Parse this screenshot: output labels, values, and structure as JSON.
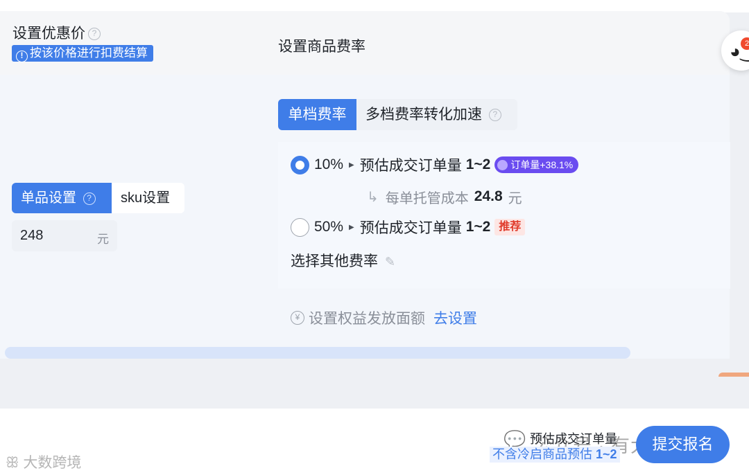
{
  "header": {
    "discount_title": "设置优惠价",
    "price_hint": "按该价格进行扣费结算",
    "rate_title": "设置商品费率"
  },
  "mascot": {
    "badge": "2"
  },
  "price_mode": {
    "tabs": [
      "单品设置",
      "sku设置"
    ],
    "selected": "单品设置",
    "price_value": "248",
    "price_unit": "元"
  },
  "rate": {
    "tabs": [
      "单档费率",
      "多档费率转化加速"
    ],
    "selected_tab": "单档费率",
    "options": [
      {
        "pct": "10%",
        "estimate_label": "预估成交订单量",
        "estimate_value": "1~2",
        "badge": "订单量+38.1%",
        "checked": true
      },
      {
        "pct": "50%",
        "estimate_label": "预估成交订单量",
        "estimate_value": "1~2",
        "badge": "推荐",
        "checked": false
      }
    ],
    "cost_label": "每单托管成本",
    "cost_value": "24.8",
    "cost_unit": "元",
    "other_rate": "选择其他费率"
  },
  "benefit": {
    "text": "设置权益发放面额",
    "link": "去设置"
  },
  "footer": {
    "estimate_label": "预估成交订单量",
    "estimate_sub": "不含冷启商品预估",
    "estimate_value": "1~2",
    "submit": "提交报名"
  },
  "watermarks": {
    "account": "公众号 · 有大猫说电商",
    "logo": "大数跨境"
  },
  "colors": {
    "accent": "#3f7de8",
    "purple_badge": "#6a4cf0",
    "recommend_red": "#e03a2a"
  }
}
